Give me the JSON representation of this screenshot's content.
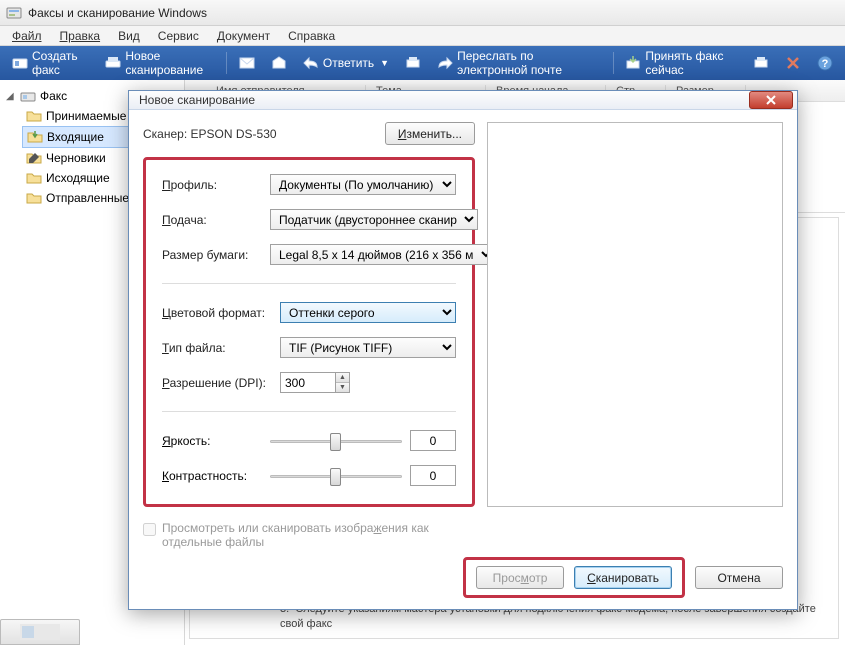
{
  "app": {
    "title": "Факсы и сканирование Windows"
  },
  "menu": {
    "file": "Файл",
    "edit": "Правка",
    "view": "Вид",
    "tools": "Сервис",
    "document": "Документ",
    "help": "Справка"
  },
  "toolbar": {
    "new_fax": "Создать факс",
    "new_scan": "Новое сканирование",
    "reply": "Ответить",
    "forward_email": "Переслать по электронной почте",
    "receive_fax_now": "Принять факс сейчас"
  },
  "sidebar": {
    "root": "Факс",
    "items": [
      {
        "label": "Принимаемые"
      },
      {
        "label": "Входящие"
      },
      {
        "label": "Черновики"
      },
      {
        "label": "Исходящие"
      },
      {
        "label": "Отправленные"
      }
    ]
  },
  "list_header": {
    "name": "Имя отправителя",
    "subject": "Тема",
    "start": "Время начала",
    "pages": "Стр...",
    "size": "Размер"
  },
  "footer": {
    "step_num": "3.",
    "step_text": "Следуйте указаниям мастера установки для подключения факс-модема; после завершения создайте свой факс"
  },
  "dialog": {
    "title": "Новое сканирование",
    "scanner_prefix": "Сканер:",
    "scanner_name": "EPSON DS-530",
    "change_btn": "Изменить...",
    "fields": {
      "profile_label": "Профиль:",
      "profile_value": "Документы (По умолчанию)",
      "source_label": "Подача:",
      "source_value": "Податчик (двустороннее сканир",
      "paper_label": "Размер бумаги:",
      "paper_value": "Legal 8,5 x 14 дюймов (216 x 356 м",
      "color_label": "Цветовой формат:",
      "color_value": "Оттенки серого",
      "filetype_label": "Тип файла:",
      "filetype_value": "TIF (Рисунок TIFF)",
      "dpi_label": "Разрешение (DPI):",
      "dpi_value": "300",
      "brightness_label": "Яркость:",
      "brightness_value": "0",
      "contrast_label": "Контрастность:",
      "contrast_value": "0"
    },
    "checkbox_label": "Просмотреть или сканировать изображения как отдельные файлы",
    "buttons": {
      "preview": "Просмотр",
      "scan": "Сканировать",
      "cancel": "Отмена"
    }
  }
}
